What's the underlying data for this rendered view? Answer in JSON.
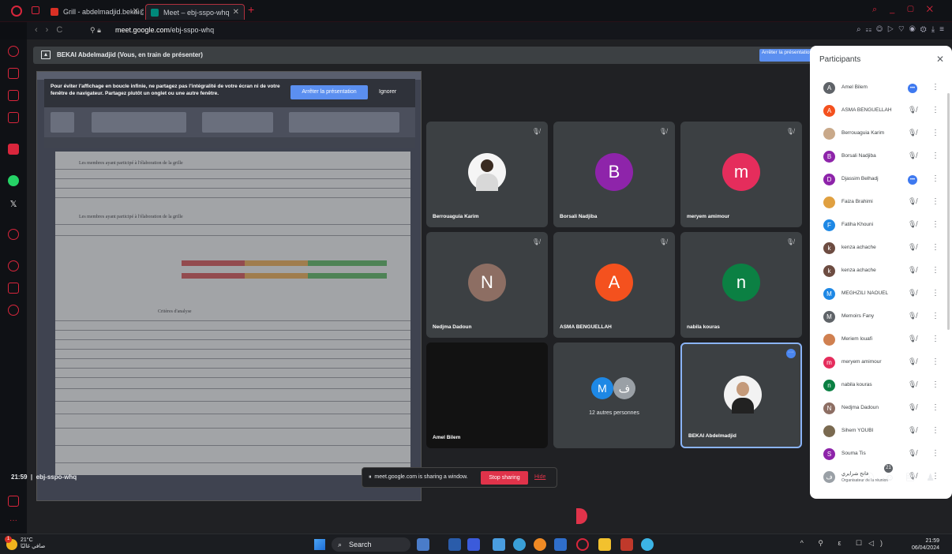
{
  "browser": {
    "tabs": [
      {
        "label": "Grill - abdelmadjid.bekai@",
        "active": false
      },
      {
        "label": "Meet – ebj-sspo-whq",
        "active": true
      }
    ],
    "url_host": "meet.google.com",
    "url_path": "/ebj-sspo-whq"
  },
  "meet": {
    "presenting_banner": "BEKAI Abdelmadjid (Vous, en train de présenter)",
    "stop_presenting_label": "Arrêter la présentation",
    "infinite_warning": "Pour éviter l'affichage en boucle infinie, ne partagez pas l'intégralité de votre écran ni de votre fenêtre de navigateur. Partagez plutôt un onglet ou une autre fenêtre.",
    "warning_stop_label": "Arrêter la présentation",
    "warning_ignore_label": "Ignorer",
    "meeting_time": "21:59",
    "meeting_code": "ebj-sspo-whq",
    "share_notice": "meet.google.com is sharing a window.",
    "stop_sharing_label": "Stop sharing",
    "hide_label": "Hide",
    "people_count": "21"
  },
  "shared_doc": {
    "caption1": "Les membres ayant participé à l'élaboration de la grille",
    "caption2": "Les membres ayant participé à l'élaboration de la grille",
    "criteria_header": "Critères d'analyse"
  },
  "tiles": [
    {
      "name": "Berrouaguia Karim",
      "initial": "",
      "color": "#ffffff",
      "photo": true
    },
    {
      "name": "Borsali Nadjiba",
      "initial": "B",
      "color": "#8e24aa"
    },
    {
      "name": "meryem amimour",
      "initial": "m",
      "color": "#e52d5c"
    },
    {
      "name": "Nedjma Dadoun",
      "initial": "N",
      "color": "#8d6e63"
    },
    {
      "name": "ASMA BENGUELLAH",
      "initial": "A",
      "color": "#f4511e"
    },
    {
      "name": "nabila kouras",
      "initial": "n",
      "color": "#0b8043"
    },
    {
      "name": "Amel Bilem"
    },
    {
      "name": "12 autres personnes"
    },
    {
      "name": "BEKAI Abdelmadjid"
    }
  ],
  "others_avatars": [
    "M",
    "ف"
  ],
  "participants_panel": {
    "title": "Participants",
    "list": [
      {
        "name": "Amel Bilem",
        "initial": "A",
        "color": "#5f6368",
        "mic": "on"
      },
      {
        "name": "ASMA BENGUELLAH",
        "initial": "A",
        "color": "#f4511e",
        "mic": "off"
      },
      {
        "name": "Berrouaguia Karim",
        "initial": "",
        "color": "#c9a98a",
        "mic": "off"
      },
      {
        "name": "Borsali Nadjiba",
        "initial": "B",
        "color": "#8e24aa",
        "mic": "off"
      },
      {
        "name": "Djassim Belhadj",
        "initial": "D",
        "color": "#8e24aa",
        "mic": "on"
      },
      {
        "name": "Faiza Brahimi",
        "initial": "",
        "color": "#e0a040",
        "mic": "off"
      },
      {
        "name": "Fatiha Khouni",
        "initial": "F",
        "color": "#1e88e5",
        "mic": "off"
      },
      {
        "name": "kenza achache",
        "initial": "k",
        "color": "#6d4c41",
        "mic": "off"
      },
      {
        "name": "kenza achache",
        "initial": "k",
        "color": "#6d4c41",
        "mic": "off"
      },
      {
        "name": "MEGHZILI NAOUEL",
        "initial": "M",
        "color": "#1e88e5",
        "mic": "off"
      },
      {
        "name": "Memoirs Fany",
        "initial": "M",
        "color": "#5f6368",
        "mic": "off"
      },
      {
        "name": "Meriem louafi",
        "initial": "",
        "color": "#d08050",
        "mic": "off"
      },
      {
        "name": "meryem amimour",
        "initial": "m",
        "color": "#e52d5c",
        "mic": "off"
      },
      {
        "name": "nabila kouras",
        "initial": "n",
        "color": "#0b8043",
        "mic": "off"
      },
      {
        "name": "Nedjma Dadoun",
        "initial": "N",
        "color": "#8d6e63",
        "mic": "off"
      },
      {
        "name": "Sihem YOUBI",
        "initial": "",
        "color": "#7a6a50",
        "mic": "off"
      },
      {
        "name": "Souma Tis",
        "initial": "S",
        "color": "#8e24aa",
        "mic": "off"
      },
      {
        "name": "فاتح شرايري",
        "initial": "ف",
        "color": "#9aa0a6",
        "mic": "off",
        "sub": "Organisateur de la réunion"
      }
    ]
  },
  "taskbar": {
    "temperature": "21°C",
    "weather_text": "صافي غالبًا",
    "search_label": "Search",
    "time": "21:59",
    "date": "06/04/2024",
    "notification_badge": "1"
  },
  "icons": {
    "mic_off": "mic-off-icon",
    "mic_on": "mic-on-icon",
    "more": "more-vert-icon"
  }
}
